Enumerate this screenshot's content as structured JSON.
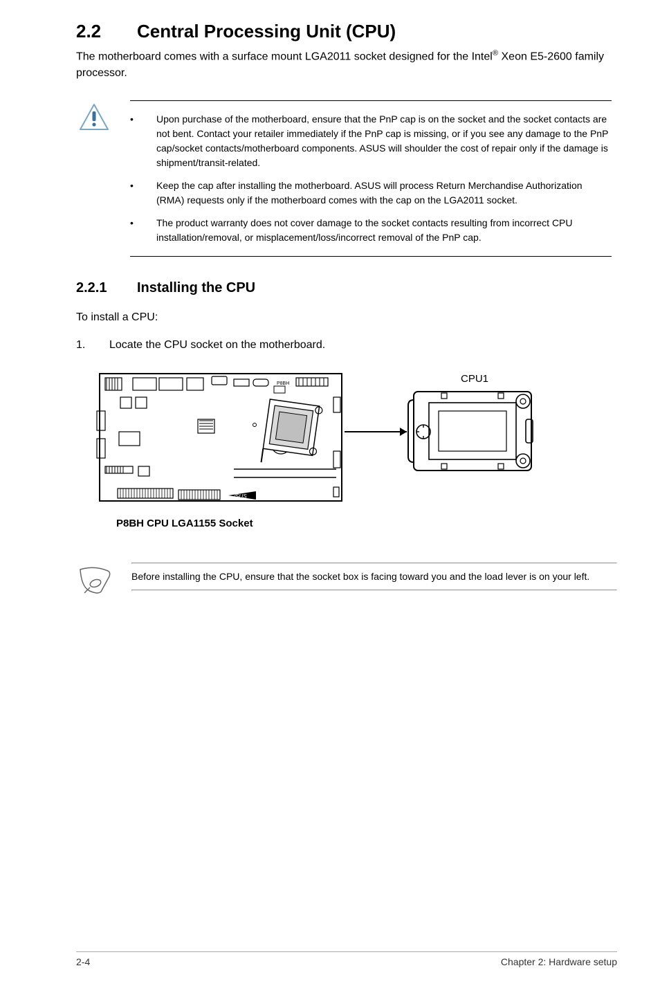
{
  "section": {
    "number": "2.2",
    "title": "Central Processing Unit (CPU)",
    "intro_pre": "The motherboard comes with a surface mount LGA2011 socket designed for the  Intel",
    "intro_reg": "®",
    "intro_post": " Xeon E5-2600 family processor."
  },
  "warning": {
    "items": [
      "Upon purchase of the motherboard, ensure that the PnP cap is on the socket and the socket contacts are not bent. Contact your retailer immediately if the PnP cap is missing, or if you see any damage to the PnP cap/socket contacts/motherboard components. ASUS will shoulder the cost of repair only if the damage is shipment/transit-related.",
      "Keep the cap after installing the motherboard. ASUS will process Return Merchandise Authorization (RMA) requests only if the motherboard comes with the cap on the LGA2011 socket.",
      "The product warranty does not cover damage to the socket contacts resulting from incorrect CPU installation/removal, or misplacement/loss/incorrect removal of the PnP cap."
    ]
  },
  "subsection": {
    "number": "2.2.1",
    "title": "Installing the CPU",
    "lead": "To install a CPU:",
    "step1_num": "1.",
    "step1_text": "Locate the CPU socket on the motherboard."
  },
  "figure": {
    "cpu_label": "CPU1",
    "caption": "P8BH CPU LGA1155 Socket"
  },
  "note": {
    "text": "Before installing the CPU, ensure that the socket box is facing toward you and the load lever is on your left."
  },
  "footer": {
    "left": "2-4",
    "right": "Chapter 2:  Hardware setup"
  }
}
